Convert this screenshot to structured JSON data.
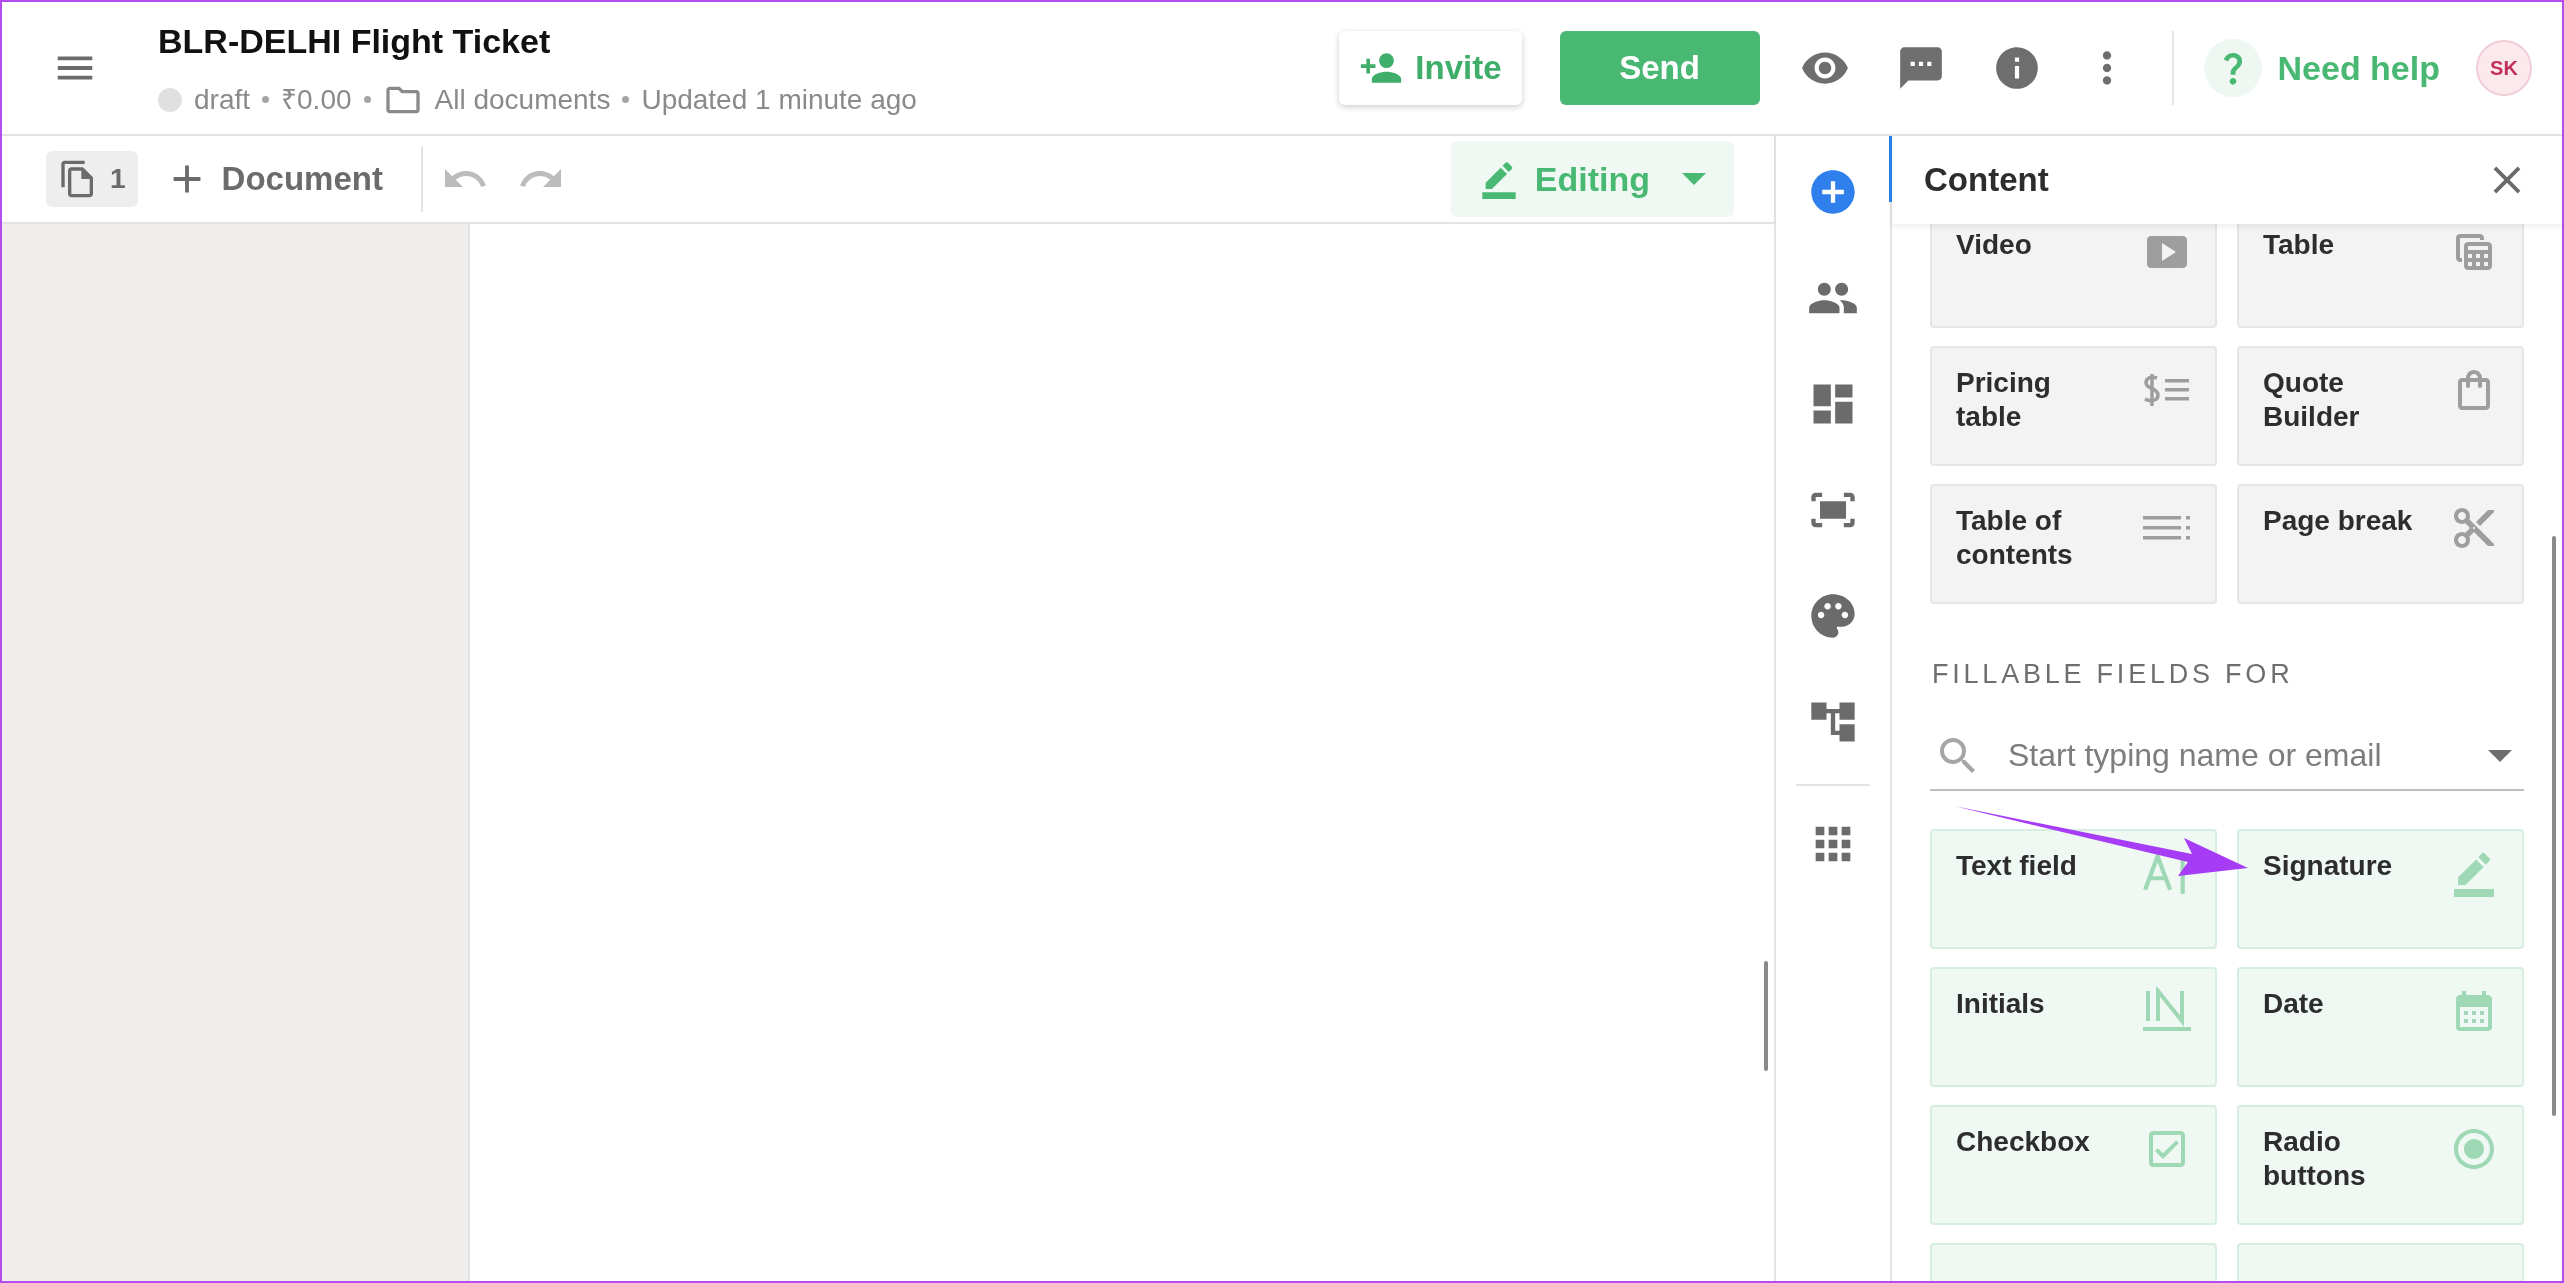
{
  "document": {
    "title": "BLR-DELHI Flight Ticket",
    "status": "draft",
    "amount": "₹0.00",
    "folder": "All documents",
    "updated": "Updated 1 minute ago"
  },
  "header_actions": {
    "invite": "Invite",
    "send": "Send",
    "help": "Need help",
    "avatar": "SK"
  },
  "toolbar": {
    "page_count": "1",
    "add_document": "Document",
    "mode": "Editing"
  },
  "rail": [
    {
      "selected": true
    },
    {
      "selected": false
    },
    {
      "selected": false
    },
    {
      "selected": false
    },
    {
      "selected": false
    },
    {
      "selected": false
    },
    {
      "selected": false
    }
  ],
  "panel": {
    "title": "Content",
    "content_blocks": [
      {
        "label": "Video"
      },
      {
        "label": "Table"
      },
      {
        "label": "Pricing table"
      },
      {
        "label": "Quote Builder"
      },
      {
        "label": "Table of contents"
      },
      {
        "label": "Page break"
      }
    ],
    "fillable_heading": "FILLABLE FIELDS FOR",
    "recipient_search": {
      "placeholder": "Start typing name or email"
    },
    "fields": [
      {
        "label": "Text field"
      },
      {
        "label": "Signature"
      },
      {
        "label": "Initials"
      },
      {
        "label": "Date"
      },
      {
        "label": "Checkbox"
      },
      {
        "label": "Radio buttons"
      }
    ]
  }
}
